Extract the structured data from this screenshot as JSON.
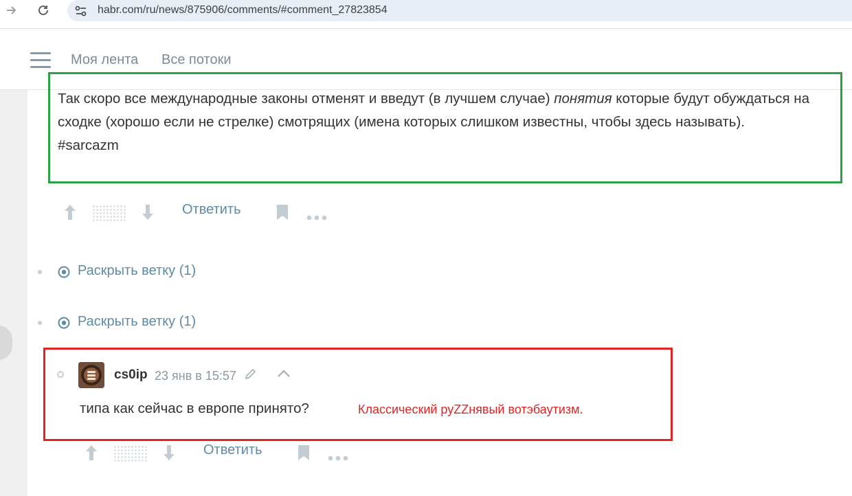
{
  "browser": {
    "url": "habr.com/ru/news/875906/comments/#comment_27823854",
    "back_icon": "arrow-right-icon",
    "reload_icon": "reload-icon"
  },
  "header": {
    "menu_icon": "burger-menu-icon",
    "nav": [
      "Моя лента",
      "Все потоки"
    ]
  },
  "comment1": {
    "text_before_em": "Так скоро все международные законы отменят и введут (в лучшем случае) ",
    "text_em": "понятия",
    "text_after_em": " которые будут обуждаться на сходке (хорошо если не стрелке) смотрящих (имена которых слишком известны, чтобы здесь называть).",
    "hashtag": "#sarcazm",
    "reply_label": "Ответить"
  },
  "threads": [
    {
      "label": "Раскрыть ветку (1)"
    },
    {
      "label": "Раскрыть ветку (1)"
    }
  ],
  "comment2": {
    "author": "cs0ip",
    "timestamp": "23 янв в 15:57",
    "text": "типа как сейчас в европе принято?",
    "annotation": "Классический руZZнявый вотэбаутизм.",
    "reply_label": "Ответить"
  },
  "colors": {
    "highlight_green": "#2ea043",
    "highlight_red": "#e02424",
    "link": "#5e8aa4"
  }
}
